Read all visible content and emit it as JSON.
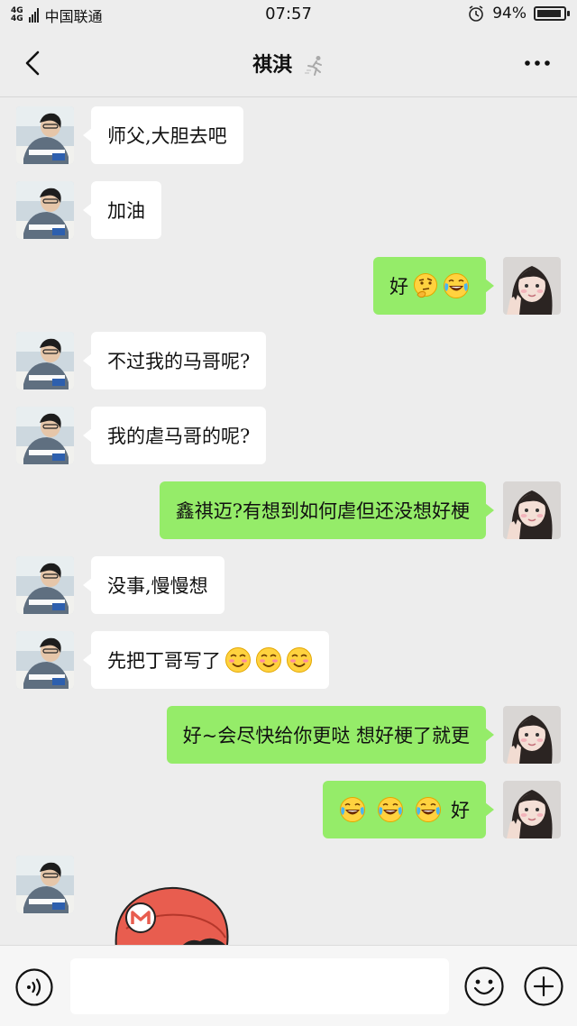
{
  "status_bar": {
    "network_top": "4G",
    "network_bottom": "4G",
    "carrier": "中国联通",
    "time": "07:57",
    "battery_percent_text": "94%",
    "battery_level": 0.94,
    "icons": [
      "signal-icon",
      "alarm-icon",
      "battery-icon"
    ]
  },
  "header": {
    "title": "祺淇",
    "icons": [
      "back-icon",
      "running-figure-icon",
      "more-icon"
    ]
  },
  "messages": [
    {
      "sender": "other",
      "text": "师父,大胆去吧",
      "emojis": []
    },
    {
      "sender": "other",
      "text": "加油",
      "emojis": []
    },
    {
      "sender": "me",
      "text": "好",
      "emojis": [
        "thinking-emoji-icon",
        "tears-of-joy-emoji-icon"
      ]
    },
    {
      "sender": "other",
      "text": "不过我的马哥呢?",
      "emojis": []
    },
    {
      "sender": "other",
      "text": "我的虐马哥的呢?",
      "emojis": []
    },
    {
      "sender": "me",
      "text": "鑫祺迈?有想到如何虐但还没想好梗",
      "emojis": []
    },
    {
      "sender": "other",
      "text": "没事,慢慢想",
      "emojis": []
    },
    {
      "sender": "other",
      "text": "先把丁哥写了",
      "emojis": [
        "flushed-smile-emoji-icon",
        "flushed-smile-emoji-icon",
        "flushed-smile-emoji-icon"
      ]
    },
    {
      "sender": "me",
      "text": "好~会尽快给你更哒 想好梗了就更",
      "emojis": []
    },
    {
      "sender": "me",
      "text": "好",
      "emojis_before": [
        "tears-of-joy-emoji-icon",
        "tears-of-joy-emoji-icon",
        "tears-of-joy-emoji-icon"
      ]
    },
    {
      "sender": "other",
      "sticker": "cartoon-boy-red-cap-sticker"
    }
  ],
  "input_bar": {
    "placeholder": "",
    "icons": [
      "voice-icon",
      "emoji-icon",
      "plus-icon"
    ]
  },
  "colors": {
    "background": "#ededed",
    "my_bubble": "#95ec69",
    "their_bubble": "#ffffff"
  }
}
